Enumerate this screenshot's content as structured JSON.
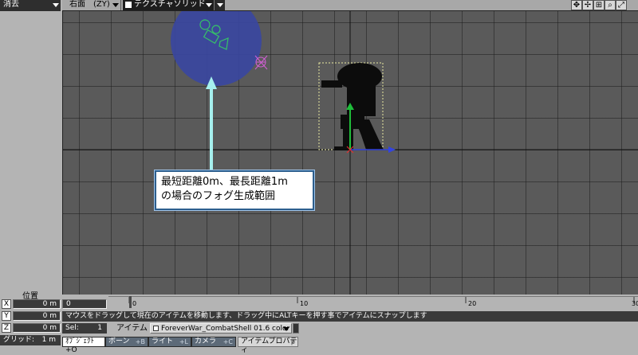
{
  "top_left": {
    "dropdown": "消去"
  },
  "viewport_header": {
    "view": "右面　(ZY)",
    "render_mode": "テクスチャソリッド",
    "icons": [
      "move-icon",
      "rotate-icon",
      "zoom-icon",
      "magnify-icon",
      "maximize-icon"
    ]
  },
  "callout": {
    "line1": "最短距離0m、最長距離1m",
    "line2": "の場合のフォグ生成範囲"
  },
  "position": {
    "label": "位置",
    "x_label": "X",
    "x_value": "0 m",
    "y_label": "Y",
    "y_value": "0 m",
    "z_label": "Z",
    "z_value": "0 m"
  },
  "grid": {
    "label": "グリッド:",
    "value": "1 m"
  },
  "timeline": {
    "start": "0",
    "ticks": [
      "0",
      "10",
      "20",
      "30"
    ]
  },
  "status": {
    "message": "マウスをドラッグして現在のアイテムを移動します、ドラッグ中にALTキーを押す事でアイテムにスナップします"
  },
  "selection": {
    "sel_label": "Sel:",
    "sel_value": "1",
    "item_label": "アイテム",
    "item_value": "ForeverWar_CombatShell 01.6 color ...",
    "properties_button": "アイテムプロパティ",
    "properties_shortcut": "p"
  },
  "modes": [
    {
      "label": "ｵﾌﾞｼﾞｪｸﾄ",
      "shortcut": "+O"
    },
    {
      "label": "ボーン",
      "shortcut": "+B"
    },
    {
      "label": "ライト",
      "shortcut": "+L"
    },
    {
      "label": "カメラ",
      "shortcut": "+C"
    }
  ],
  "colors": {
    "fog_sphere": "#3a46a0",
    "callout_border": "#2d5f8e",
    "pointer": "#a6f0ee",
    "camera": "#36c268",
    "light": "#d35fd6",
    "axis_y": "#1fbd3a",
    "axis_z": "#3344e0",
    "active_mode": "#ffffff",
    "mode_button": "#5d6a78"
  }
}
